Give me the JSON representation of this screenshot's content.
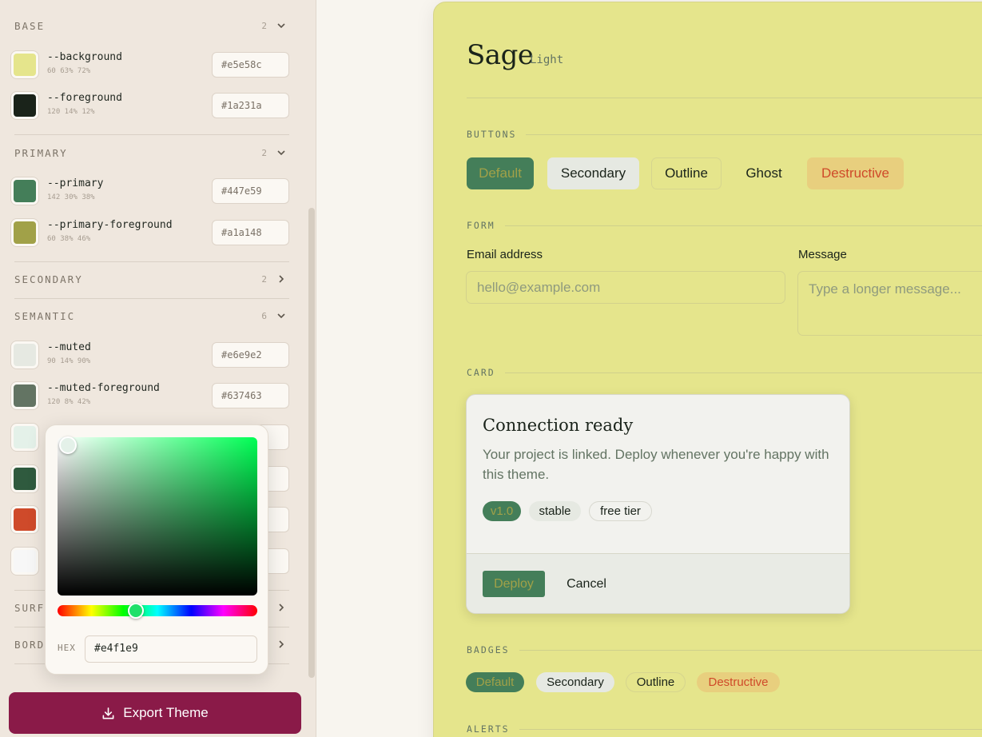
{
  "sidebar": {
    "groups": {
      "base": {
        "title": "BASE",
        "count": "2"
      },
      "primary": {
        "title": "PRIMARY",
        "count": "2"
      },
      "secondary": {
        "title": "SECONDARY",
        "count": "2"
      },
      "semantic": {
        "title": "SEMANTIC",
        "count": "6"
      },
      "surface": {
        "title": "SURF"
      },
      "border": {
        "title": "BORD"
      }
    },
    "vars": [
      {
        "name": "--background",
        "hsl": "60 63% 72%",
        "hex": "#e5e58c",
        "color": "#e5e58c"
      },
      {
        "name": "--foreground",
        "hsl": "120 14% 12%",
        "hex": "#1a231a",
        "color": "#1a231a"
      },
      {
        "name": "--primary",
        "hsl": "142 30% 38%",
        "hex": "#447e59",
        "color": "#447e59"
      },
      {
        "name": "--primary-foreground",
        "hsl": "60 38% 46%",
        "hex": "#a1a148",
        "color": "#a1a148"
      },
      {
        "name": "--muted",
        "hsl": "90 14% 90%",
        "hex": "#e6e9e2",
        "color": "#e6e9e2"
      },
      {
        "name": "--muted-foreground",
        "hsl": "120 8% 42%",
        "hex": "#637463",
        "color": "#637463"
      }
    ],
    "hidden_swatches": [
      "#e4f1e9",
      "#2f5a3e",
      "#cf4a2a",
      "#f7f7f7"
    ],
    "export_label": "Export Theme"
  },
  "picker": {
    "hex_label": "HEX",
    "hex_value": "#e4f1e9",
    "hue_color": "#00ff55",
    "saturation": 0.05,
    "value": 0.95
  },
  "preview": {
    "theme_name": "Sage",
    "mode": "Light",
    "sections": {
      "buttons": "BUTTONS",
      "form": "FORM",
      "card": "CARD",
      "badges": "BADGES",
      "alerts": "ALERTS"
    },
    "buttons": {
      "default": "Default",
      "secondary": "Secondary",
      "outline": "Outline",
      "ghost": "Ghost",
      "destructive": "Destructive"
    },
    "form": {
      "email_label": "Email address",
      "email_placeholder": "hello@example.com",
      "message_label": "Message",
      "message_placeholder": "Type a longer message..."
    },
    "card": {
      "title": "Connection ready",
      "description": "Your project is linked. Deploy whenever you're happy with this theme.",
      "chips": [
        "v1.0",
        "stable",
        "free tier"
      ],
      "deploy": "Deploy",
      "cancel": "Cancel"
    },
    "badges": {
      "default": "Default",
      "secondary": "Secondary",
      "outline": "Outline",
      "destructive": "Destructive"
    }
  },
  "colors": {
    "accent_export": "#8a1a48",
    "background": "#e5e58c",
    "primary": "#447e59",
    "destructive": "#cf4a2a"
  }
}
